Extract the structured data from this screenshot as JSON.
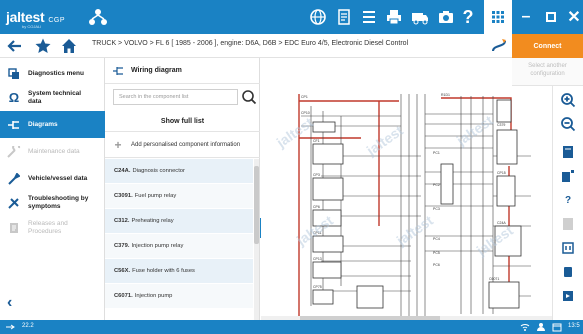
{
  "app": {
    "logo": "jaltest",
    "logo_suffix": "CGP",
    "logo_sub": "by COJALI"
  },
  "navbar": {
    "crumbs": "TRUCK > VOLVO > FL 6 [ 1985 - 2006 ], engine: D6A, D6B > EDC Euro 4/5, Electronic Diesel Control"
  },
  "connect": {
    "label": "Connect",
    "select_config": "Select another configuration"
  },
  "sidebar": {
    "items": [
      {
        "label": "Diagnostics menu"
      },
      {
        "label": "System technical data"
      },
      {
        "label": "Diagrams"
      },
      {
        "label": "Maintenance data"
      },
      {
        "label": "Vehicle/vessel data"
      },
      {
        "label": "Troubleshooting by symptoms"
      },
      {
        "label": "Releases and Procedures"
      }
    ]
  },
  "panel": {
    "title": "Wiring diagram",
    "search_placeholder": "Search in the component list",
    "show_full": "Show full list",
    "add_info": "Add personalised component information",
    "components": [
      {
        "code": "C24A.",
        "name": "Diagnosis connector"
      },
      {
        "code": "C3091.",
        "name": "Fuel pump relay"
      },
      {
        "code": "C312.",
        "name": "Preheating relay"
      },
      {
        "code": "C379.",
        "name": "Injection pump relay"
      },
      {
        "code": "C56X.",
        "name": "Fuse holder with 6 fuses"
      },
      {
        "code": "C6071.",
        "name": "Injection pump"
      }
    ]
  },
  "diagram": {
    "watermark": "jaltest",
    "labels": [
      "CP10",
      "CP11",
      "CP13",
      "CP75",
      "CF1",
      "CP3",
      "CP6",
      "PC1",
      "PC2",
      "PC3",
      "PC4",
      "PC5",
      "PC6",
      "C24A",
      "C379",
      "CP1",
      "CP15",
      "C6071",
      "R1D1"
    ]
  },
  "statusbar": {
    "version": "22.2",
    "time": "13:5"
  },
  "colors": {
    "primary": "#1a82c4",
    "accent": "#f28c1f",
    "wire_red": "#c0392b"
  }
}
